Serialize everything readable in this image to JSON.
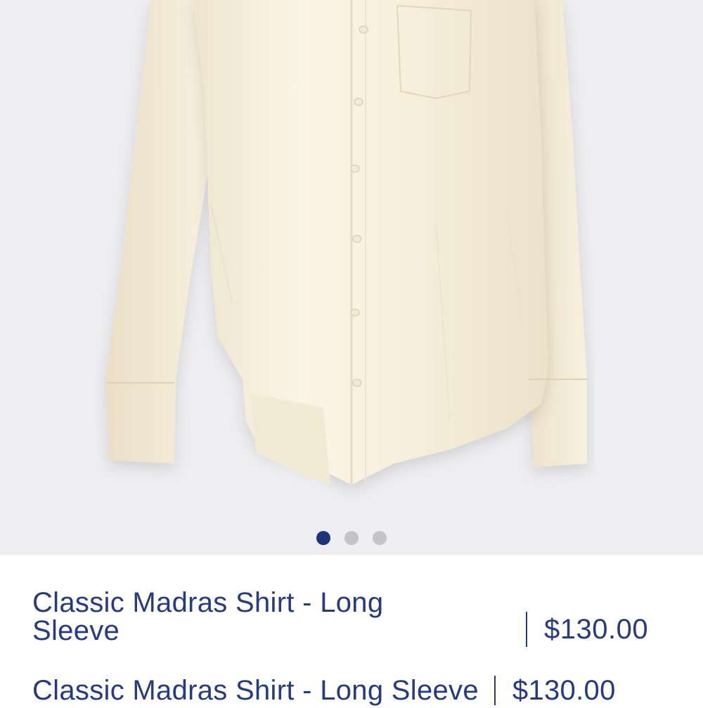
{
  "product": {
    "title_line1": "Classic Madras Shirt - Long",
    "title_line2": "Sleeve",
    "price": "$130.00",
    "full_title": "Classic Madras Shirt - Long Sleeve"
  },
  "gallery": {
    "image_subject": "cream long-sleeve button-up shirt",
    "total_images": 3,
    "active_index": 0
  },
  "colors": {
    "brand_navy": "#253a80",
    "gallery_bg": "#eeeef0",
    "shirt_cream": "#f8f1e0"
  }
}
